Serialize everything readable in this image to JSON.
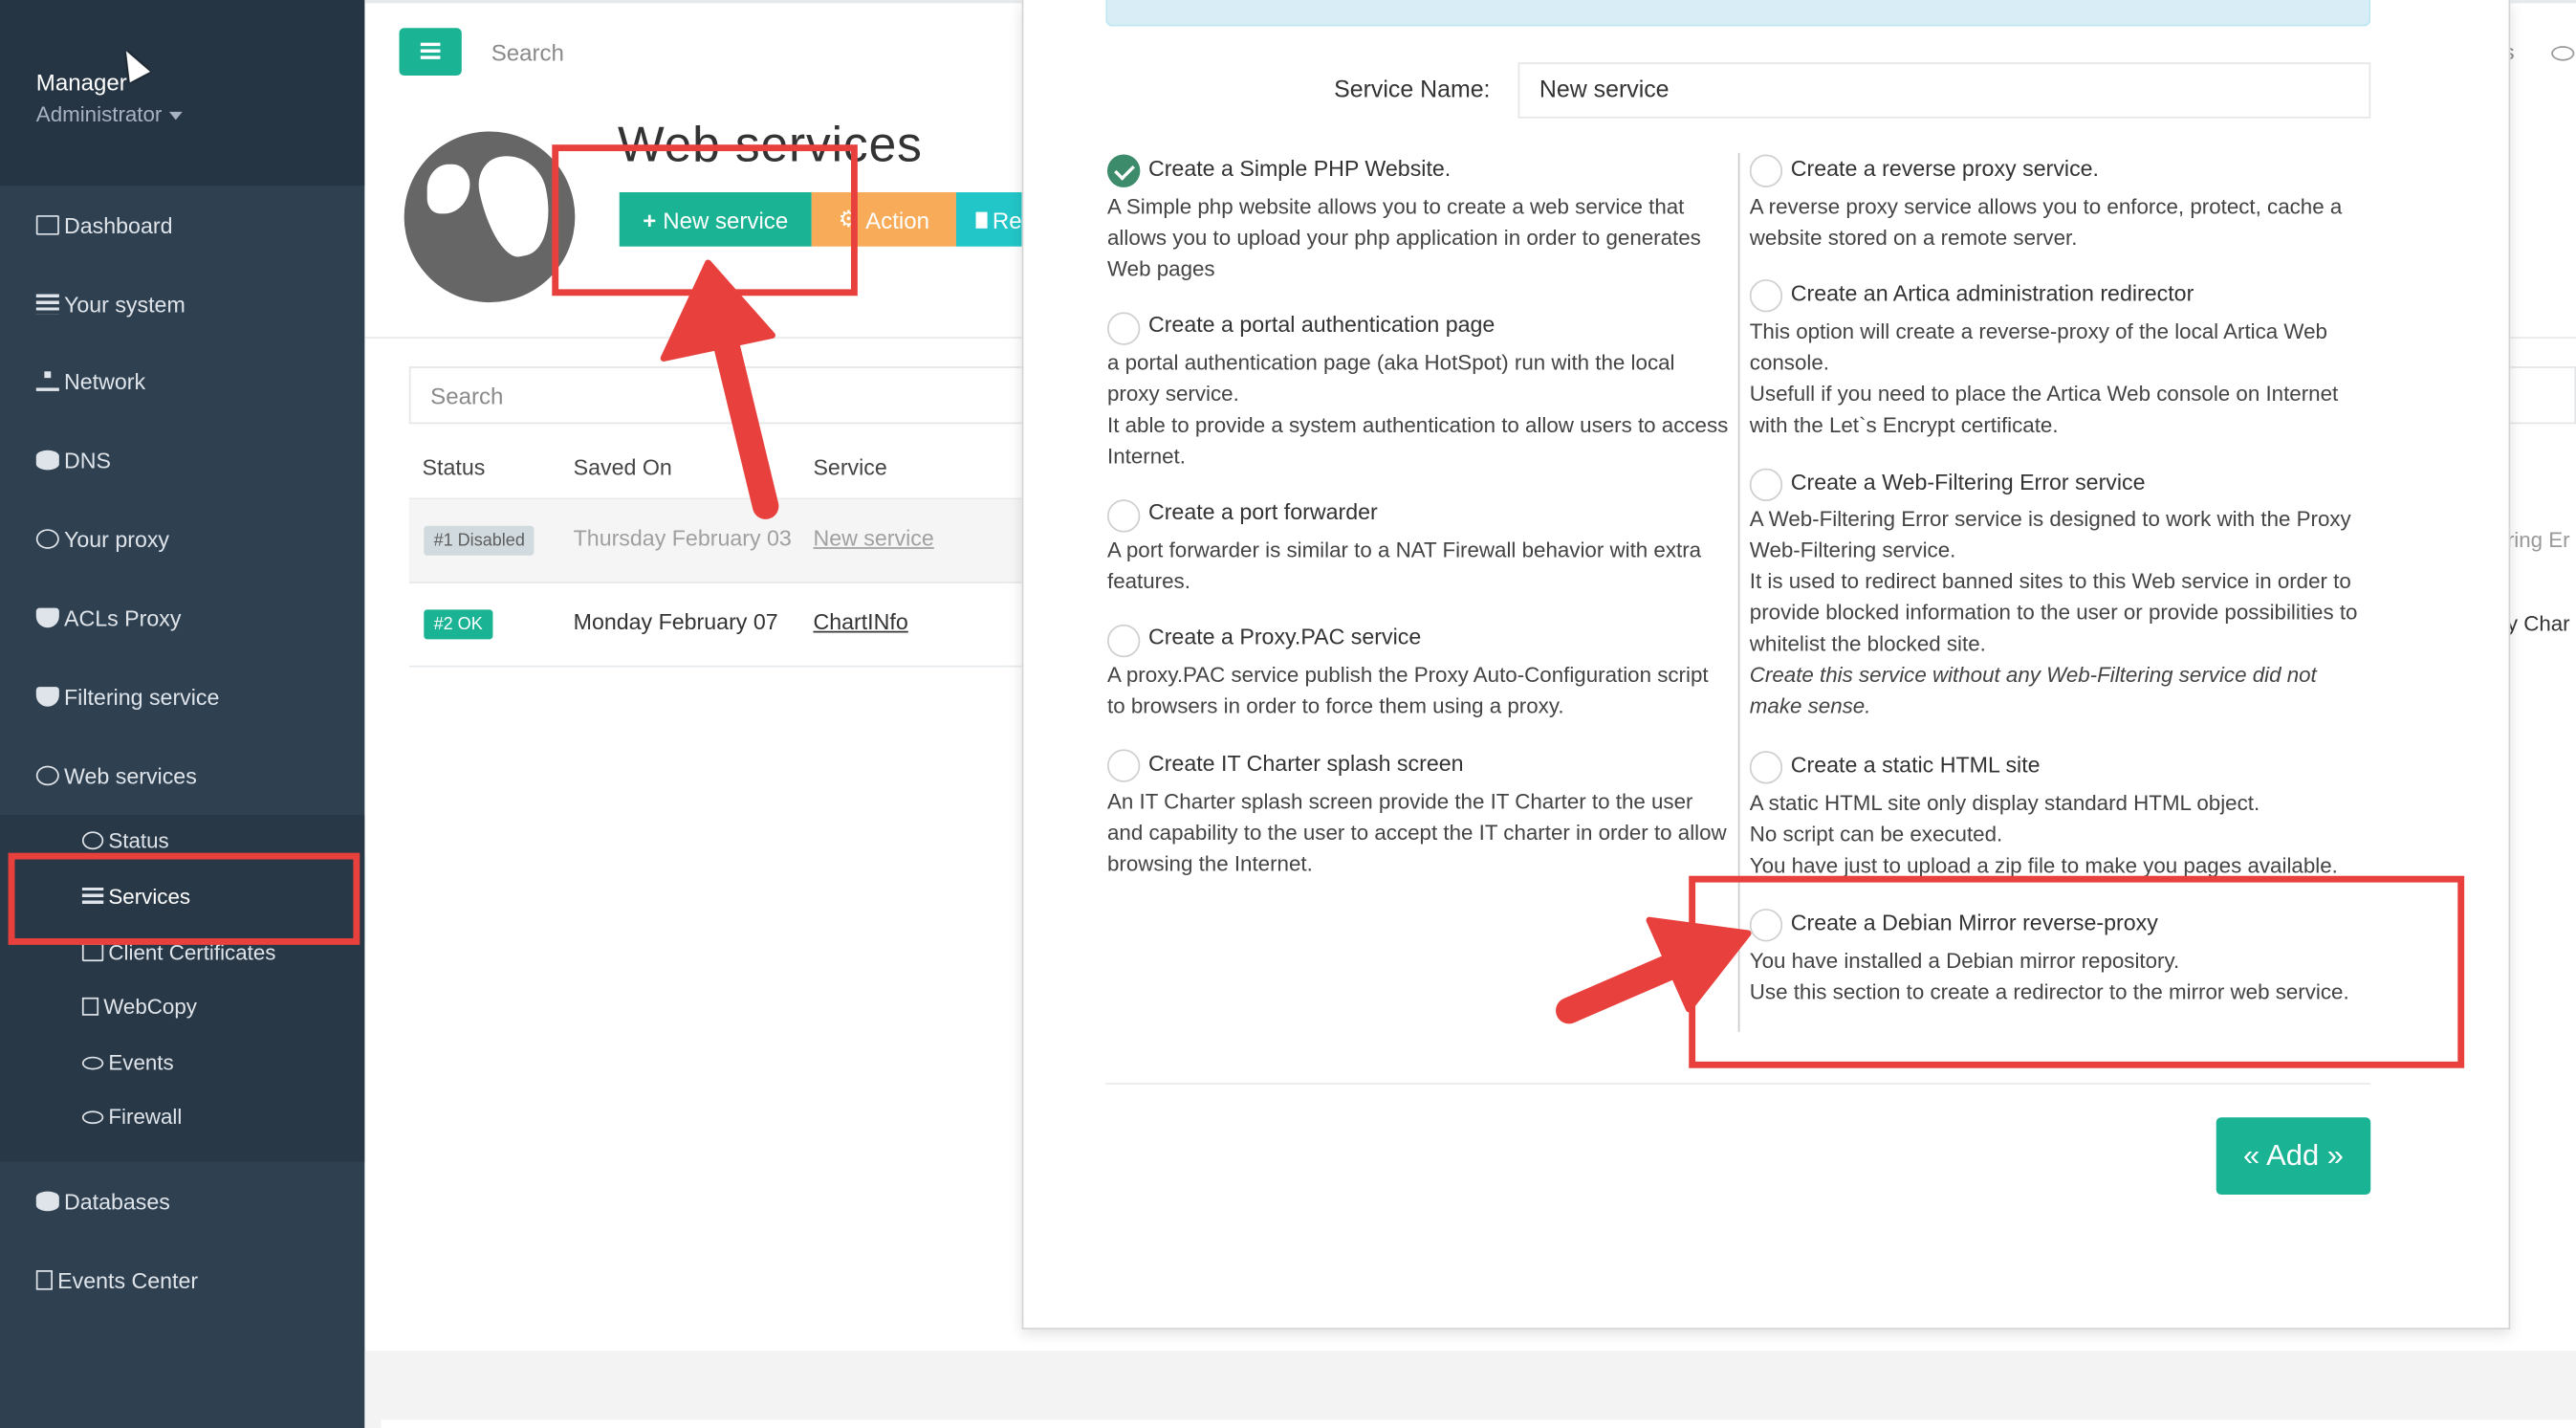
{
  "sidebar": {
    "user_name": "Manager",
    "user_role": "Administrator",
    "items": [
      {
        "label": "Dashboard",
        "icon": "dashboard-icon"
      },
      {
        "label": "Your system",
        "icon": "list-icon"
      },
      {
        "label": "Network",
        "icon": "sitemap-icon"
      },
      {
        "label": "DNS",
        "icon": "database-icon"
      },
      {
        "label": "Your proxy",
        "icon": "globe-icon"
      },
      {
        "label": "ACLs Proxy",
        "icon": "shield-icon"
      },
      {
        "label": "Filtering service",
        "icon": "shield-icon"
      },
      {
        "label": "Web services",
        "icon": "globe-icon"
      },
      {
        "label": "Databases",
        "icon": "database-icon"
      },
      {
        "label": "Events Center",
        "icon": "file-icon"
      }
    ],
    "submenu": [
      {
        "label": "Status",
        "icon": "gears-icon"
      },
      {
        "label": "Services",
        "icon": "list-alt-icon"
      },
      {
        "label": "Client Certificates",
        "icon": "certificate-icon"
      },
      {
        "label": "WebCopy",
        "icon": "copy-icon"
      },
      {
        "label": "Events",
        "icon": "eye-icon"
      },
      {
        "label": "Firewall",
        "icon": "eye-icon"
      }
    ]
  },
  "header": {
    "search_label": "Search",
    "page_title": "Web services",
    "new_service_label": "New service",
    "action_label": "Action",
    "third_button_label": "Re"
  },
  "table": {
    "search_label": "Search",
    "columns": [
      "Status",
      "Saved On",
      "Service"
    ],
    "rows": [
      {
        "badge": "#1 Disabled",
        "saved_on": "Thursday February 03",
        "service": "New service",
        "right_fragment": "ring Er"
      },
      {
        "badge": "#2 OK",
        "saved_on": "Monday February 07",
        "service": "ChartINfo",
        "right_fragment": "y Char"
      }
    ],
    "header_right_fragment": "s"
  },
  "modal": {
    "service_name_label": "Service Name:",
    "service_name_value": "New service",
    "add_button_label": "« Add »",
    "left_options": [
      {
        "title": "Create a Simple PHP Website.",
        "checked": true,
        "desc": [
          "A Simple php website allows you to create a web service that allows you to upload your php application in order to generates Web pages"
        ]
      },
      {
        "title": "Create a portal authentication page",
        "checked": false,
        "desc": [
          "a portal authentication page (aka HotSpot) run with the local proxy service.",
          "It able to provide a system authentication to allow users to access Internet."
        ]
      },
      {
        "title": "Create a port forwarder",
        "checked": false,
        "desc": [
          "A port forwarder is similar to a NAT Firewall behavior with extra features."
        ]
      },
      {
        "title": "Create a Proxy.PAC service",
        "checked": false,
        "desc": [
          "A proxy.PAC service publish the Proxy Auto-Configuration script to browsers in order to force them using a proxy."
        ]
      },
      {
        "title": "Create IT Charter splash screen",
        "checked": false,
        "desc": [
          "An IT Charter splash screen provide the IT Charter to the user and capability to the user to accept the IT charter in order to allow browsing the Internet."
        ]
      }
    ],
    "right_options": [
      {
        "title": "Create a reverse proxy service.",
        "checked": false,
        "desc": [
          "A reverse proxy service allows you to enforce, protect, cache a website stored on a remote server."
        ]
      },
      {
        "title": "Create an Artica administration redirector",
        "checked": false,
        "desc": [
          "This option will create a reverse-proxy of the local Artica Web console.",
          "Usefull if you need to place the Artica Web console on Internet with the Let`s Encrypt certificate."
        ]
      },
      {
        "title": "Create a Web-Filtering Error service",
        "checked": false,
        "desc": [
          "A Web-Filtering Error service is designed to work with the Proxy Web-Filtering service.",
          "It is used to redirect banned sites to this Web service in order to provide blocked information to the user or provide possibilities to whitelist the blocked site."
        ],
        "note": "Create this service without any Web-Filtering service did not make sense."
      },
      {
        "title": "Create a static HTML site",
        "checked": false,
        "desc": [
          "A static HTML site only display standard HTML object.",
          "No script can be executed.",
          "You have just to upload a zip file to make you pages available."
        ]
      },
      {
        "title": "Create a Debian Mirror reverse-proxy",
        "checked": false,
        "desc": [
          "You have installed a Debian mirror repository.",
          "Use this section to create a redirector to the mirror web service."
        ]
      }
    ]
  },
  "colors": {
    "sidebar_bg": "#2f4050",
    "accent_green": "#1ab394",
    "warning_orange": "#f8ac59",
    "annotation_red": "#e8413d"
  }
}
